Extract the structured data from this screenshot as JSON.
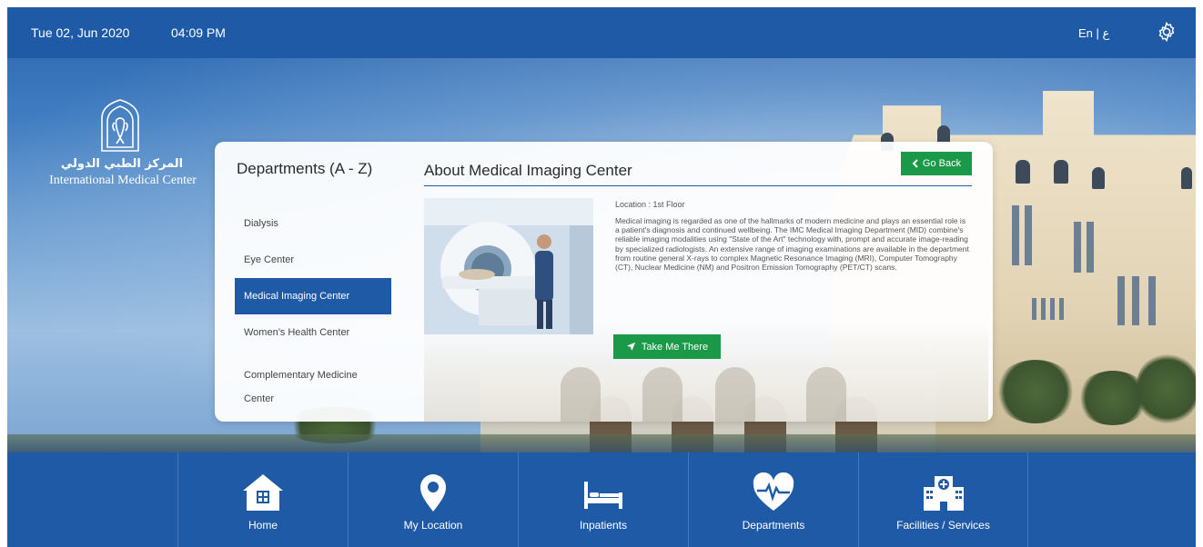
{
  "topbar": {
    "date": "Tue 02, Jun 2020",
    "time": "04:09 PM",
    "language_toggle": "En | ع",
    "settings_icon": "gear-icon"
  },
  "logo": {
    "arabic_name": "المركز الطبي الدولي",
    "english_name": "International Medical Center",
    "icon": "tree-dome-logo"
  },
  "departments": {
    "heading": "Departments (A - Z)",
    "items": [
      {
        "label": "Dialysis",
        "active": false
      },
      {
        "label": "Eye Center",
        "active": false
      },
      {
        "label": "Medical Imaging Center",
        "active": true
      },
      {
        "label": "Women's Health Center",
        "active": false
      },
      {
        "label": "Complementary Medicine Center",
        "active": false
      }
    ]
  },
  "about": {
    "title": "About Medical Imaging Center",
    "go_back_label": "Go Back",
    "location": "Location : 1st Floor",
    "description": "Medical imaging is regarded as one of the hallmarks of modern medicine and plays an essential role is a patient's diagnosis and continued wellbeing. The IMC Medical Imaging Department (MID) combine's reliable imaging modalities using \"State of the Art\" technology with, prompt and accurate image-reading by specialized radiologists. An extensive range of imaging examinations are available in the department from routine general X-rays to complex Magnetic Resonance Imaging (MRI), Computer Tomography (CT), Nuclear Medicine (NM) and Positron Emission Tomography (PET/CT) scans.",
    "take_me_there_label": "Take Me There"
  },
  "bottom_nav": [
    {
      "label": "Home",
      "icon": "home-icon"
    },
    {
      "label": "My Location",
      "icon": "location-pin-icon"
    },
    {
      "label": "Inpatients",
      "icon": "bed-icon"
    },
    {
      "label": "Departments",
      "icon": "heart-pulse-icon"
    },
    {
      "label": "Facilities / Services",
      "icon": "hospital-building-icon"
    }
  ],
  "colors": {
    "primary_blue": "#1f5aa6",
    "action_green": "#1a9a48",
    "panel_white": "#ffffff"
  }
}
